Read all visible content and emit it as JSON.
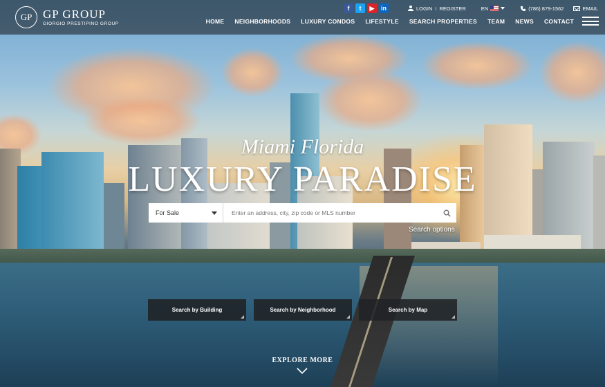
{
  "brand": {
    "mark": "GP",
    "name": "GP GROUP",
    "tagline": "GIORGIO PRESTIPINO GROUP"
  },
  "topbar": {
    "social": [
      {
        "name": "facebook-icon",
        "glyph": "f"
      },
      {
        "name": "twitter-icon",
        "glyph": "t"
      },
      {
        "name": "youtube-icon",
        "glyph": "▶"
      },
      {
        "name": "linkedin-icon",
        "glyph": "in"
      }
    ],
    "login": "LOGIN",
    "separator": "I",
    "register": "REGISTER",
    "language": "EN",
    "phone": "(786) 879-1562",
    "email": "EMAIL"
  },
  "nav": {
    "items": [
      "HOME",
      "NEIGHBORHOODS",
      "LUXURY CONDOS",
      "LIFESTYLE",
      "SEARCH PROPERTIES",
      "TEAM",
      "NEWS",
      "CONTACT"
    ]
  },
  "hero": {
    "subtitle": "Miami Florida",
    "title": "LUXURY PARADISE"
  },
  "search": {
    "type_selected": "For Sale",
    "placeholder": "Enter an address, city, zip code or MLS number",
    "options_link": "Search options"
  },
  "quick_search": {
    "building": "Search by Building",
    "neighborhood": "Search by Neighborhood",
    "map": "Search by Map"
  },
  "explore": "EXPLORE MORE",
  "colors": {
    "facebook": "#3b5998",
    "twitter": "#1da1f2",
    "youtube": "#d9252a",
    "linkedin": "#0a66c2",
    "button_bg": "#202226"
  }
}
